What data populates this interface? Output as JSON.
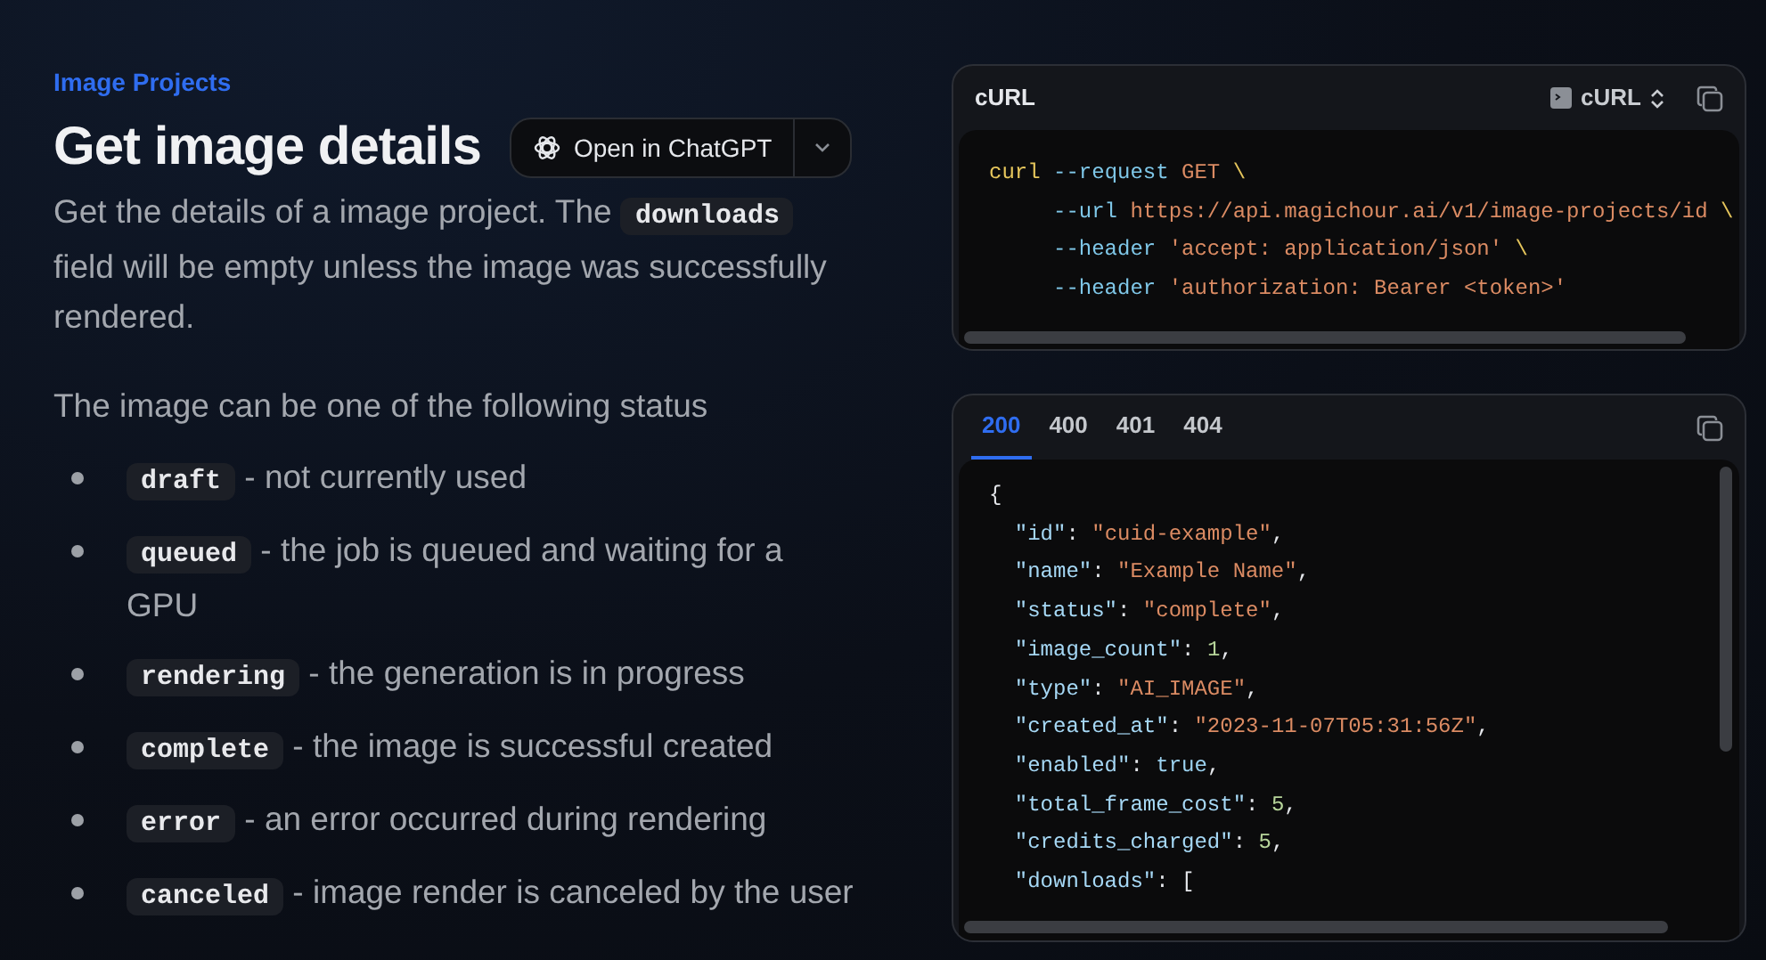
{
  "breadcrumb": "Image Projects",
  "title": "Get image details",
  "open_button": {
    "label": "Open in ChatGPT"
  },
  "description": [
    {
      "kind": "text",
      "text": "Get the details of a image project. The "
    },
    {
      "kind": "code",
      "text": "downloads"
    },
    {
      "kind": "text",
      "text": " field will be empty unless the image was successfully rendered."
    }
  ],
  "status_intro": "The image can be one of the following status",
  "statuses": [
    {
      "code": "draft",
      "text": "- not currently used"
    },
    {
      "code": "queued",
      "text": "- the job is queued and waiting for a GPU"
    },
    {
      "code": "rendering",
      "text": "- the generation is in progress"
    },
    {
      "code": "complete",
      "text": "- the image is successful created"
    },
    {
      "code": "error",
      "text": "- an error occurred during rendering"
    },
    {
      "code": "canceled",
      "text": "- image render is canceled by the user"
    }
  ],
  "request_panel": {
    "title": "cURL",
    "language": "cURL",
    "lines": [
      [
        {
          "kind": "command",
          "text": "curl"
        },
        {
          "kind": "flag",
          "text": " --request"
        },
        {
          "kind": "string",
          "text": " GET"
        },
        {
          "kind": "command",
          "text": " \\"
        }
      ],
      [
        {
          "kind": "flag",
          "text": "     --url"
        },
        {
          "kind": "string",
          "text": " https://api.magichour.ai/v1/image-projects/id"
        },
        {
          "kind": "command",
          "text": " \\"
        }
      ],
      [
        {
          "kind": "flag",
          "text": "     --header"
        },
        {
          "kind": "string",
          "text": " 'accept: application/json'"
        },
        {
          "kind": "command",
          "text": " \\"
        }
      ],
      [
        {
          "kind": "flag",
          "text": "     --header"
        },
        {
          "kind": "string",
          "text": " 'authorization: Bearer <token>'"
        }
      ]
    ]
  },
  "response_panel": {
    "tabs": [
      {
        "label": "200",
        "selected": true
      },
      {
        "label": "400",
        "selected": false
      },
      {
        "label": "401",
        "selected": false
      },
      {
        "label": "404",
        "selected": false
      }
    ],
    "lines": [
      [
        {
          "kind": "plain",
          "text": "{"
        }
      ],
      [
        {
          "kind": "key",
          "text": "  \"id\""
        },
        {
          "kind": "plain",
          "text": ": "
        },
        {
          "kind": "string",
          "text": "\"cuid-example\""
        },
        {
          "kind": "plain",
          "text": ","
        }
      ],
      [
        {
          "kind": "key",
          "text": "  \"name\""
        },
        {
          "kind": "plain",
          "text": ": "
        },
        {
          "kind": "string",
          "text": "\"Example Name\""
        },
        {
          "kind": "plain",
          "text": ","
        }
      ],
      [
        {
          "kind": "key",
          "text": "  \"status\""
        },
        {
          "kind": "plain",
          "text": ": "
        },
        {
          "kind": "string",
          "text": "\"complete\""
        },
        {
          "kind": "plain",
          "text": ","
        }
      ],
      [
        {
          "kind": "key",
          "text": "  \"image_count\""
        },
        {
          "kind": "plain",
          "text": ": "
        },
        {
          "kind": "number",
          "text": "1"
        },
        {
          "kind": "plain",
          "text": ","
        }
      ],
      [
        {
          "kind": "key",
          "text": "  \"type\""
        },
        {
          "kind": "plain",
          "text": ": "
        },
        {
          "kind": "string",
          "text": "\"AI_IMAGE\""
        },
        {
          "kind": "plain",
          "text": ","
        }
      ],
      [
        {
          "kind": "key",
          "text": "  \"created_at\""
        },
        {
          "kind": "plain",
          "text": ": "
        },
        {
          "kind": "string",
          "text": "\"2023-11-07T05:31:56Z\""
        },
        {
          "kind": "plain",
          "text": ","
        }
      ],
      [
        {
          "kind": "key",
          "text": "  \"enabled\""
        },
        {
          "kind": "plain",
          "text": ": "
        },
        {
          "kind": "boolean",
          "text": "true"
        },
        {
          "kind": "plain",
          "text": ","
        }
      ],
      [
        {
          "kind": "key",
          "text": "  \"total_frame_cost\""
        },
        {
          "kind": "plain",
          "text": ": "
        },
        {
          "kind": "number",
          "text": "5"
        },
        {
          "kind": "plain",
          "text": ","
        }
      ],
      [
        {
          "kind": "key",
          "text": "  \"credits_charged\""
        },
        {
          "kind": "plain",
          "text": ": "
        },
        {
          "kind": "number",
          "text": "5"
        },
        {
          "kind": "plain",
          "text": ","
        }
      ],
      [
        {
          "kind": "key",
          "text": "  \"downloads\""
        },
        {
          "kind": "plain",
          "text": ": ["
        }
      ]
    ]
  }
}
